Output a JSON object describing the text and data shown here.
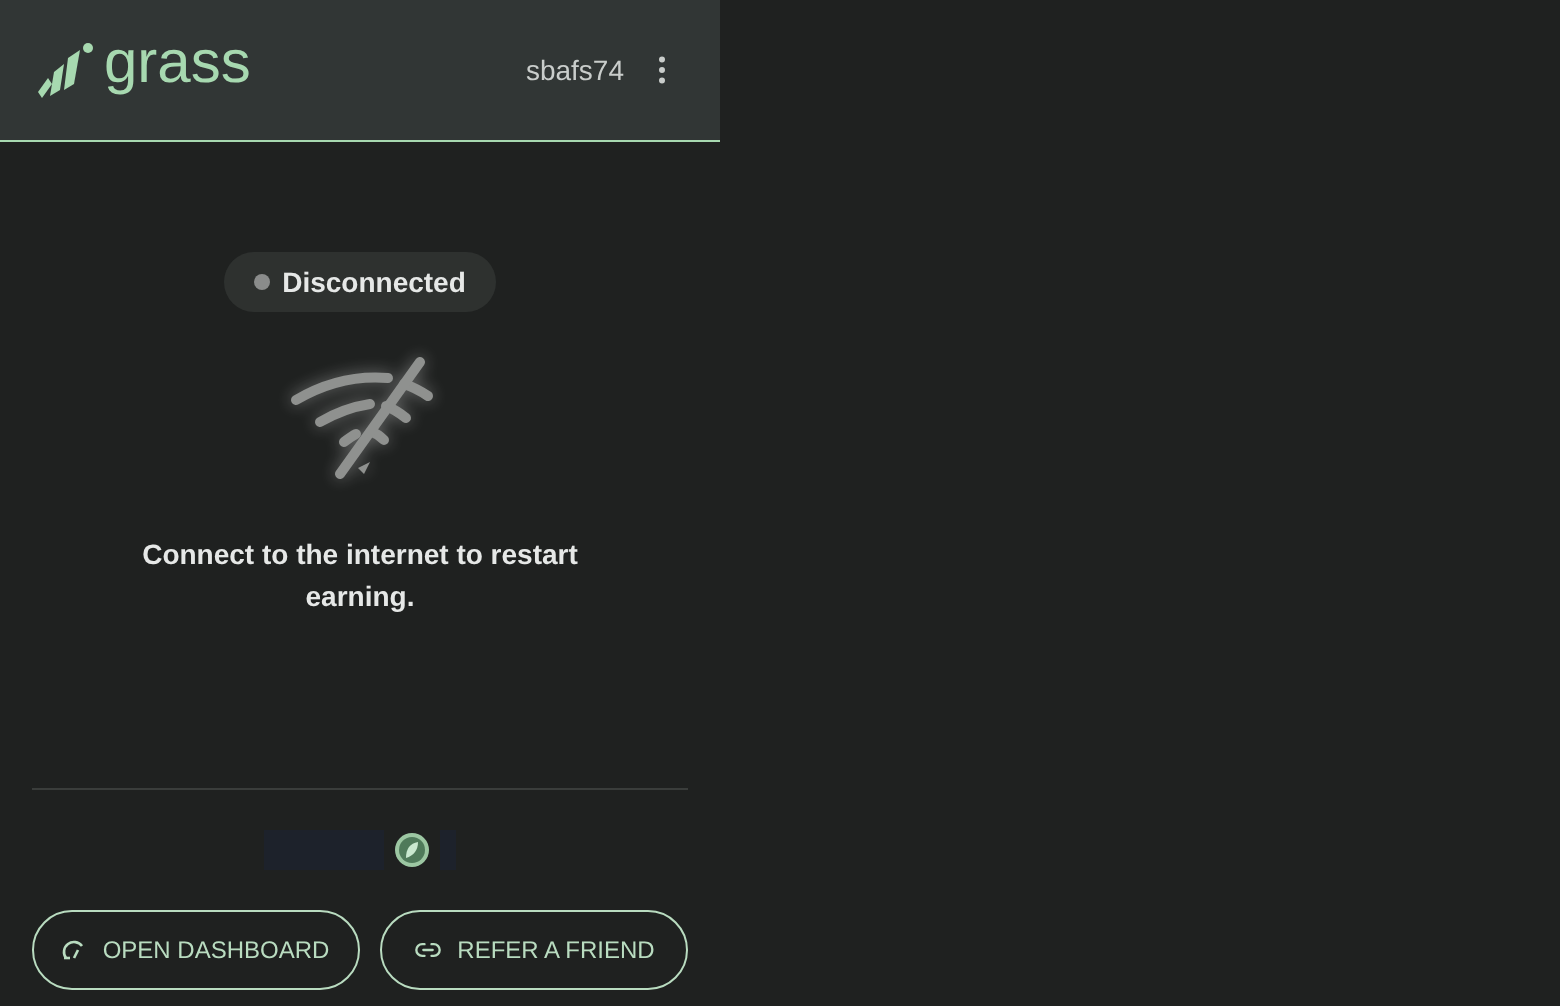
{
  "header": {
    "logo_text": "grass",
    "username": "sbafs74"
  },
  "status": {
    "label": "Disconnected",
    "connected": false
  },
  "message": "Connect to the internet to restart earning.",
  "buttons": [
    {
      "label": "OPEN DASHBOARD",
      "kind": "dashboard"
    },
    {
      "label": "REFER A FRIEND",
      "kind": "refer"
    }
  ]
}
